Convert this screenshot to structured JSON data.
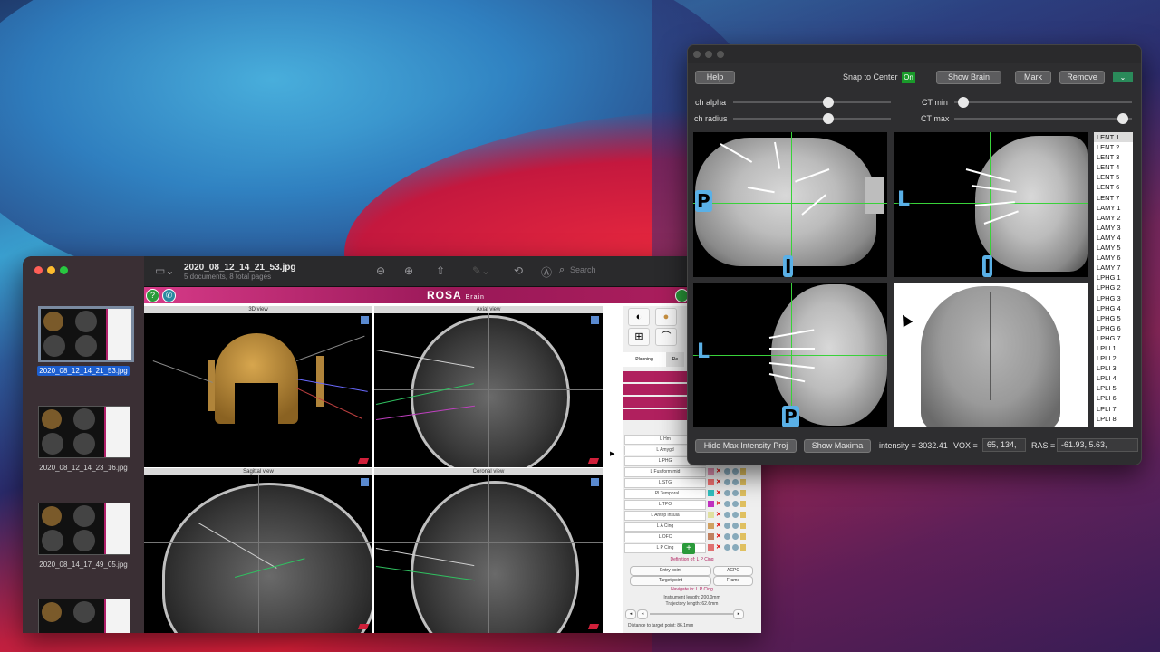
{
  "preview": {
    "file_title": "2020_08_12_14_21_53.jpg",
    "file_subtitle": "5 documents, 8 total pages",
    "search_placeholder": "Search",
    "thumbnails": [
      {
        "label": "2020_08_12_14_21_53.jpg",
        "selected": true
      },
      {
        "label": "2020_08_12_14_23_16.jpg",
        "selected": false
      },
      {
        "label": "2020_08_14_17_49_05.jpg",
        "selected": false
      },
      {
        "label": "",
        "selected": false
      }
    ],
    "doc": {
      "logo": "ROSA",
      "logo_sub": "Brain",
      "views": {
        "v3d": "3D view",
        "axial": "Axial view",
        "sagittal": "Sagittal view",
        "coronal": "Coronal view"
      },
      "tabs": [
        "Planning",
        "Re"
      ],
      "trajectories": [
        "L Hm",
        "L Amygd",
        "L PHG",
        "L Fusiform mid",
        "L STG",
        "L Pl Temporal",
        "L TPO",
        "L Antep insula",
        "L A Cing",
        "L OFC",
        "L P Cing"
      ],
      "swatch_colors": [
        "#f0f0f0",
        "#e0a0c0",
        "#f0a0a0",
        "#e090b0",
        "#f07070",
        "#30c0c0",
        "#c030c0",
        "#e0e0a0",
        "#d0a060",
        "#c08060",
        "#e07070"
      ],
      "definition_text": "Definition of: L P Cing",
      "buttons": {
        "entry": "Entry point",
        "acpc": "ACPC",
        "target": "Target point",
        "frame": "Frame"
      },
      "navigate_text": "Navigate in: L P Cing",
      "instrument_length": "Instrument length: 200.0mm",
      "trajectory_length": "Trajectory length: 62.6mm",
      "distance_text": "Distance to target point: 86.1mm"
    }
  },
  "viewer": {
    "help": "Help",
    "snap_label": "Snap to Center",
    "snap_state": "On",
    "show_brain": "Show Brain",
    "mark": "Mark",
    "remove": "Remove",
    "dropdown_glyph": "⌄",
    "sliders": {
      "ch_alpha": {
        "label": "ch alpha",
        "value": 0.61
      },
      "ch_radius": {
        "label": "ch radius",
        "value": 0.61
      },
      "ct_min": {
        "label": "CT min",
        "value": 0.02
      },
      "ct_max": {
        "label": "CT max",
        "value": 0.98
      }
    },
    "orientation": {
      "p1": "P",
      "l1": "L",
      "i1": "I",
      "i2": "I",
      "l2": "L",
      "p2": "P"
    },
    "electrodes": [
      "LENT 1",
      "LENT 2",
      "LENT 3",
      "LENT 4",
      "LENT 5",
      "LENT 6",
      "LENT 7",
      "LAMY 1",
      "LAMY 2",
      "LAMY 3",
      "LAMY 4",
      "LAMY 5",
      "LAMY 6",
      "LAMY 7",
      "LPHG 1",
      "LPHG 2",
      "LPHG 3",
      "LPHG 4",
      "LPHG 5",
      "LPHG 6",
      "LPHG 7",
      "LPLI 1",
      "LPLI 2",
      "LPLI 3",
      "LPLI 4",
      "LPLI 5",
      "LPLI 6",
      "LPLI 7",
      "LPLI 8"
    ],
    "selected_electrode": "LENT 1",
    "hide_mip": "Hide Max Intensity Proj",
    "show_maxima": "Show Maxima",
    "intensity": "intensity = 3032.41",
    "vox_label": "VOX =",
    "vox_value": "65, 134,",
    "ras_label": "RAS =",
    "ras_value": "-61.93, 5.63,"
  }
}
